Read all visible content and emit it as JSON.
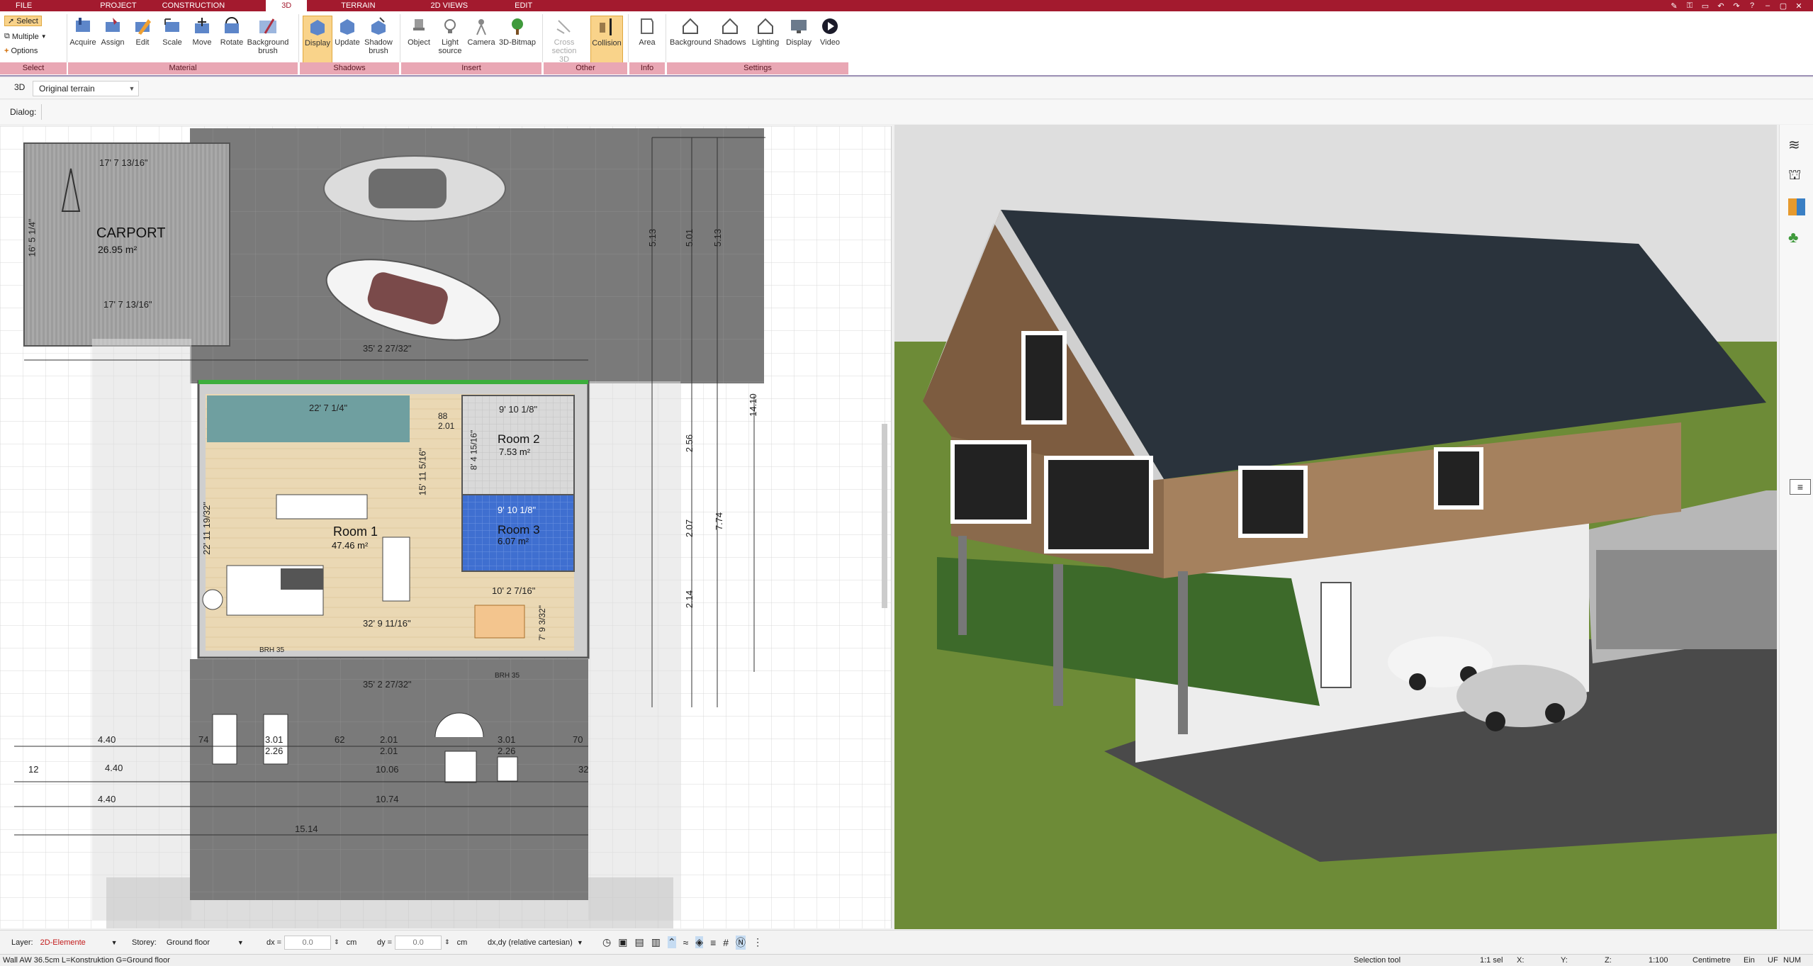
{
  "tabs": [
    "FILE",
    "PROJECT",
    "CONSTRUCTION",
    "3D",
    "TERRAIN",
    "2D VIEWS",
    "EDIT"
  ],
  "active_tab": "3D",
  "select_group": {
    "select_label": "Select",
    "multiple_label": "Multiple",
    "options_label": "Options",
    "group_label": "Select"
  },
  "groups": [
    {
      "label": "Material",
      "tools": [
        "Acquire",
        "Assign",
        "Edit",
        "Scale",
        "Move",
        "Rotate",
        "Background brush"
      ]
    },
    {
      "label": "Shadows",
      "tools": [
        "Display",
        "Update",
        "Shadow brush"
      ]
    },
    {
      "label": "Insert",
      "tools": [
        "Object",
        "Light source",
        "Camera",
        "3D-Bitmap"
      ]
    },
    {
      "label": "Other",
      "tools": [
        "Cross section 3D",
        "Collision"
      ]
    },
    {
      "label": "Info",
      "tools": [
        "Area"
      ]
    },
    {
      "label": "Settings",
      "tools": [
        "Background",
        "Shadows",
        "Lighting",
        "Display",
        "Video"
      ]
    }
  ],
  "view_bar": {
    "mode": "3D",
    "terrain": "Original terrain"
  },
  "dialog_label": "Dialog:",
  "plan": {
    "carport_title": "CARPORT",
    "carport_area": "26.95 m²",
    "dim_carport_top": "17' 7 13/16\"",
    "dim_carport_bottom": "17' 7 13/16\"",
    "dim_carport_side": "16' 5 1/4\"",
    "dim_drive_width": "35' 2 27/32\"",
    "dim_drive_width_2": "35' 2 27/32\"",
    "room1_title": "Room 1",
    "room1_area": "47.46 m²",
    "room2_title": "Room 2",
    "room2_area": "7.53 m²",
    "room3_title": "Room 3",
    "room3_area": "6.07 m²",
    "dim_stairs": "22' 7 1/4\"",
    "dim_room1_height": "15' 11 5/16\"",
    "dim_room1_side": "22' 11 19/32\"",
    "dim_room1_bottom": "32' 9 11/16\"",
    "dim_room2_top": "9' 10 1/8\"",
    "dim_room2_side": "8' 4 15/16\"",
    "dim_room3_top": "9' 10 1/8\"",
    "dim_dining": "10' 2 7/16\"",
    "dim_dining_side": "7' 9 3/32\"",
    "dim_right_1": "5.13",
    "dim_right_2": "5.01",
    "dim_right_3": "5.13",
    "dim_right_4": "14.10",
    "dim_right_5": "7.74",
    "dim_right_6": "2.56",
    "dim_right_7": "2.07",
    "dim_right_8": "2.14",
    "dim_b1": "4.40",
    "dim_b2": "4.40",
    "dim_b3": "4.40",
    "dim_b4": "3.01",
    "dim_b5": "2.26",
    "dim_b6": "2.01",
    "dim_b7": "2.01",
    "dim_b8": "3.01",
    "dim_b9": "2.26",
    "dim_b10": "10.06",
    "dim_b11": "10.74",
    "dim_b12": "15.14",
    "dim_b13": "62",
    "dim_b14": "74",
    "dim_b15": "70",
    "dim_b16": "12",
    "dim_b17": "32",
    "brh": "BRH 35",
    "dim_88": "88",
    "dim_201": "2.01"
  },
  "status": {
    "layer_label": "Layer:",
    "layer_value": "2D-Elemente",
    "storey_label": "Storey:",
    "storey_value": "Ground floor",
    "dx_label": "dx =",
    "dx_value": "0.0",
    "dx_unit": "cm",
    "dy_label": "dy =",
    "dy_value": "0.0",
    "dy_unit": "cm",
    "coord_mode": "dx,dy (relative cartesian)"
  },
  "bottom": {
    "info": "Wall AW 36.5cm L=Konstruktion G=Ground floor",
    "tool": "Selection tool",
    "sel": "1:1 sel",
    "x": "X:",
    "y": "Y:",
    "z": "Z:",
    "scale": "1:100",
    "unit": "Centimetre",
    "ein": "Ein",
    "uf": "UF",
    "num": "NUM"
  },
  "colors": {
    "brand": "#a31a2e",
    "ribbon_label": "#e9a7b4",
    "active_tool": "#f9d38a",
    "room1_floor": "#ead8b4",
    "room3_floor": "#3f6fd0",
    "roof": "#2a333c",
    "wood": "#8a6a4c",
    "lawn": "#6d8b37"
  }
}
